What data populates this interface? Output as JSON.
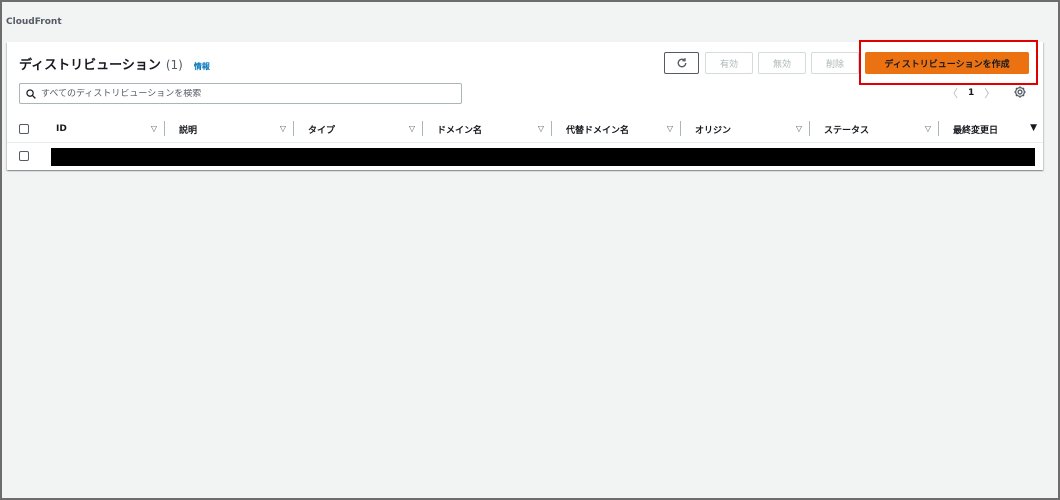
{
  "service": {
    "name": "CloudFront"
  },
  "panel": {
    "title": "ディストリビューション",
    "count": "(1)",
    "info_link": "情報"
  },
  "toolbar": {
    "refresh_icon": "refresh-icon",
    "enable_label": "有効",
    "disable_label": "無効",
    "delete_label": "削除",
    "create_label": "ディストリビューションを作成"
  },
  "search": {
    "placeholder": "すべてのディストリビューションを検索"
  },
  "pagination": {
    "current_page": "1"
  },
  "table": {
    "columns": [
      "ID",
      "説明",
      "タイプ",
      "ドメイン名",
      "代替ドメイン名",
      "オリジン",
      "ステータス",
      "最終変更日"
    ],
    "row_count": 1
  },
  "colors": {
    "primary_button": "#ec7211",
    "link": "#0073bb",
    "highlight": "#e00000"
  }
}
